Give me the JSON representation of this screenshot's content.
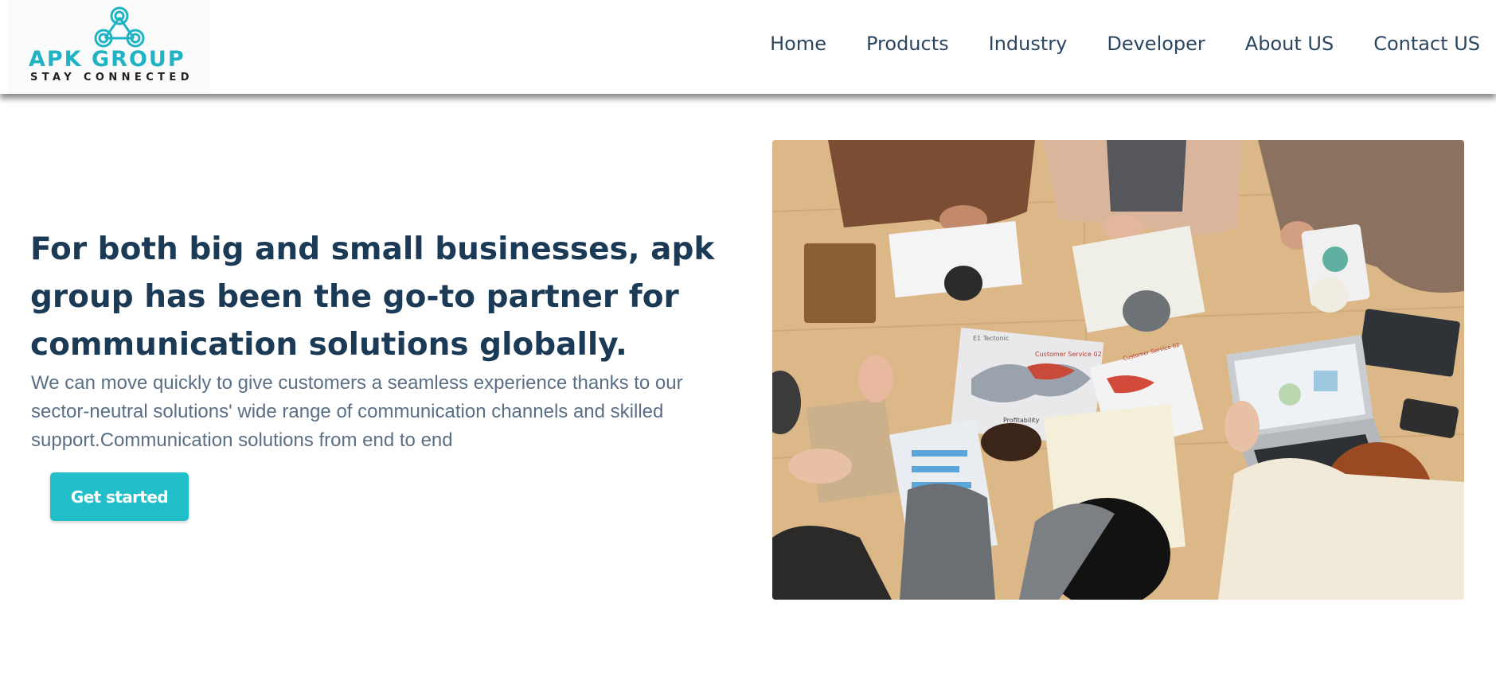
{
  "brand": {
    "name": "APK GROUP",
    "tagline": "STAY CONNECTED",
    "logo_icon": "triangle-knot-logo-icon",
    "accent_color": "#1fb3c4"
  },
  "nav": {
    "items": [
      {
        "label": "Home"
      },
      {
        "label": "Products"
      },
      {
        "label": "Industry"
      },
      {
        "label": "Developer"
      },
      {
        "label": "About US"
      },
      {
        "label": "Contact US"
      }
    ]
  },
  "hero": {
    "title": "For both big and small businesses, apk group has been the go-to partner for communication solutions globally.",
    "description": "We can move quickly to give customers a seamless experience thanks to our sector-neutral solutions' wide range of communication channels and skilled support.Communication solutions from end to end",
    "cta_label": "Get started",
    "cta_color": "#22bfcb",
    "image": "team-meeting-photo",
    "image_labels": {
      "map_left": "E1 Tectonic",
      "map_right": "Customer Service 02",
      "map_bottom": "Profitability",
      "paper_right": "Customer Service 02"
    }
  }
}
